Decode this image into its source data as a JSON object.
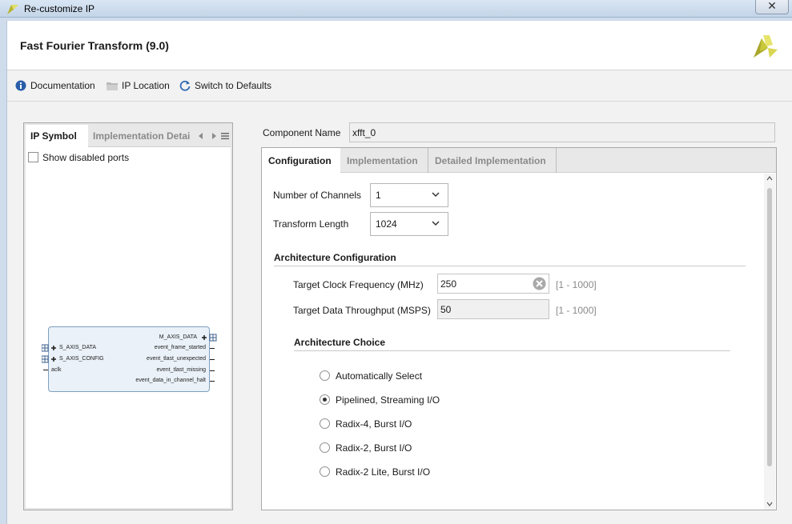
{
  "window": {
    "title": "Re-customize IP",
    "close_label": "✕"
  },
  "header": {
    "ip_title": "Fast Fourier Transform (9.0)"
  },
  "toolbar": {
    "documentation": "Documentation",
    "ip_location": "IP Location",
    "switch_defaults": "Switch to Defaults"
  },
  "left_panel": {
    "tabs": [
      {
        "label": "IP Symbol",
        "active": true
      },
      {
        "label": "Implementation Detai",
        "active": false
      }
    ],
    "show_disabled_ports": {
      "label": "Show disabled ports",
      "checked": false
    },
    "symbol": {
      "left_ports": [
        "S_AXIS_DATA",
        "S_AXIS_CONFIG",
        "aclk"
      ],
      "right_ports": [
        "M_AXIS_DATA",
        "event_frame_started",
        "event_tlast_unexpected",
        "event_tlast_missing",
        "event_data_in_channel_halt"
      ]
    }
  },
  "component_name": {
    "label": "Component Name",
    "value": "xfft_0"
  },
  "right_tabs": [
    {
      "label": "Configuration",
      "active": true
    },
    {
      "label": "Implementation",
      "active": false
    },
    {
      "label": "Detailed Implementation",
      "active": false
    }
  ],
  "config": {
    "channels": {
      "label": "Number of Channels",
      "value": "1"
    },
    "transform_length": {
      "label": "Transform Length",
      "value": "1024"
    },
    "arch_config": {
      "title": "Architecture Configuration",
      "clock": {
        "label": "Target Clock Frequency (MHz)",
        "value": "250",
        "range": "[1 - 1000]"
      },
      "throughput": {
        "label": "Target Data Throughput (MSPS)",
        "value": "50",
        "range": "[1 - 1000]"
      }
    },
    "arch_choice": {
      "title": "Architecture Choice",
      "options": [
        {
          "label": "Automatically Select",
          "checked": false
        },
        {
          "label": "Pipelined, Streaming I/O",
          "checked": true
        },
        {
          "label": "Radix-4, Burst I/O",
          "checked": false
        },
        {
          "label": "Radix-2, Burst I/O",
          "checked": false
        },
        {
          "label": "Radix-2 Lite, Burst I/O",
          "checked": false
        }
      ]
    }
  },
  "colors": {
    "info_blue": "#2a5ea8",
    "logo_yellow": "#c8c83a",
    "refresh_blue": "#2f6bb5"
  }
}
